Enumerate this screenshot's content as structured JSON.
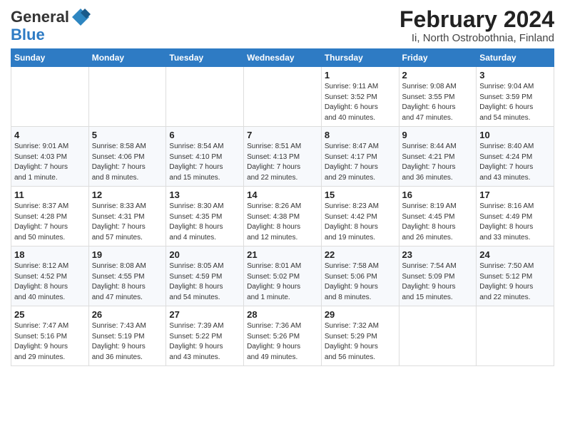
{
  "logo": {
    "text_general": "General",
    "text_blue": "Blue"
  },
  "title": {
    "month_year": "February 2024",
    "location": "Ii, North Ostrobothnia, Finland"
  },
  "days_of_week": [
    "Sunday",
    "Monday",
    "Tuesday",
    "Wednesday",
    "Thursday",
    "Friday",
    "Saturday"
  ],
  "weeks": [
    [
      {
        "day": "",
        "info": ""
      },
      {
        "day": "",
        "info": ""
      },
      {
        "day": "",
        "info": ""
      },
      {
        "day": "",
        "info": ""
      },
      {
        "day": "1",
        "info": "Sunrise: 9:11 AM\nSunset: 3:52 PM\nDaylight: 6 hours\nand 40 minutes."
      },
      {
        "day": "2",
        "info": "Sunrise: 9:08 AM\nSunset: 3:55 PM\nDaylight: 6 hours\nand 47 minutes."
      },
      {
        "day": "3",
        "info": "Sunrise: 9:04 AM\nSunset: 3:59 PM\nDaylight: 6 hours\nand 54 minutes."
      }
    ],
    [
      {
        "day": "4",
        "info": "Sunrise: 9:01 AM\nSunset: 4:03 PM\nDaylight: 7 hours\nand 1 minute."
      },
      {
        "day": "5",
        "info": "Sunrise: 8:58 AM\nSunset: 4:06 PM\nDaylight: 7 hours\nand 8 minutes."
      },
      {
        "day": "6",
        "info": "Sunrise: 8:54 AM\nSunset: 4:10 PM\nDaylight: 7 hours\nand 15 minutes."
      },
      {
        "day": "7",
        "info": "Sunrise: 8:51 AM\nSunset: 4:13 PM\nDaylight: 7 hours\nand 22 minutes."
      },
      {
        "day": "8",
        "info": "Sunrise: 8:47 AM\nSunset: 4:17 PM\nDaylight: 7 hours\nand 29 minutes."
      },
      {
        "day": "9",
        "info": "Sunrise: 8:44 AM\nSunset: 4:21 PM\nDaylight: 7 hours\nand 36 minutes."
      },
      {
        "day": "10",
        "info": "Sunrise: 8:40 AM\nSunset: 4:24 PM\nDaylight: 7 hours\nand 43 minutes."
      }
    ],
    [
      {
        "day": "11",
        "info": "Sunrise: 8:37 AM\nSunset: 4:28 PM\nDaylight: 7 hours\nand 50 minutes."
      },
      {
        "day": "12",
        "info": "Sunrise: 8:33 AM\nSunset: 4:31 PM\nDaylight: 7 hours\nand 57 minutes."
      },
      {
        "day": "13",
        "info": "Sunrise: 8:30 AM\nSunset: 4:35 PM\nDaylight: 8 hours\nand 4 minutes."
      },
      {
        "day": "14",
        "info": "Sunrise: 8:26 AM\nSunset: 4:38 PM\nDaylight: 8 hours\nand 12 minutes."
      },
      {
        "day": "15",
        "info": "Sunrise: 8:23 AM\nSunset: 4:42 PM\nDaylight: 8 hours\nand 19 minutes."
      },
      {
        "day": "16",
        "info": "Sunrise: 8:19 AM\nSunset: 4:45 PM\nDaylight: 8 hours\nand 26 minutes."
      },
      {
        "day": "17",
        "info": "Sunrise: 8:16 AM\nSunset: 4:49 PM\nDaylight: 8 hours\nand 33 minutes."
      }
    ],
    [
      {
        "day": "18",
        "info": "Sunrise: 8:12 AM\nSunset: 4:52 PM\nDaylight: 8 hours\nand 40 minutes."
      },
      {
        "day": "19",
        "info": "Sunrise: 8:08 AM\nSunset: 4:55 PM\nDaylight: 8 hours\nand 47 minutes."
      },
      {
        "day": "20",
        "info": "Sunrise: 8:05 AM\nSunset: 4:59 PM\nDaylight: 8 hours\nand 54 minutes."
      },
      {
        "day": "21",
        "info": "Sunrise: 8:01 AM\nSunset: 5:02 PM\nDaylight: 9 hours\nand 1 minute."
      },
      {
        "day": "22",
        "info": "Sunrise: 7:58 AM\nSunset: 5:06 PM\nDaylight: 9 hours\nand 8 minutes."
      },
      {
        "day": "23",
        "info": "Sunrise: 7:54 AM\nSunset: 5:09 PM\nDaylight: 9 hours\nand 15 minutes."
      },
      {
        "day": "24",
        "info": "Sunrise: 7:50 AM\nSunset: 5:12 PM\nDaylight: 9 hours\nand 22 minutes."
      }
    ],
    [
      {
        "day": "25",
        "info": "Sunrise: 7:47 AM\nSunset: 5:16 PM\nDaylight: 9 hours\nand 29 minutes."
      },
      {
        "day": "26",
        "info": "Sunrise: 7:43 AM\nSunset: 5:19 PM\nDaylight: 9 hours\nand 36 minutes."
      },
      {
        "day": "27",
        "info": "Sunrise: 7:39 AM\nSunset: 5:22 PM\nDaylight: 9 hours\nand 43 minutes."
      },
      {
        "day": "28",
        "info": "Sunrise: 7:36 AM\nSunset: 5:26 PM\nDaylight: 9 hours\nand 49 minutes."
      },
      {
        "day": "29",
        "info": "Sunrise: 7:32 AM\nSunset: 5:29 PM\nDaylight: 9 hours\nand 56 minutes."
      },
      {
        "day": "",
        "info": ""
      },
      {
        "day": "",
        "info": ""
      }
    ]
  ]
}
